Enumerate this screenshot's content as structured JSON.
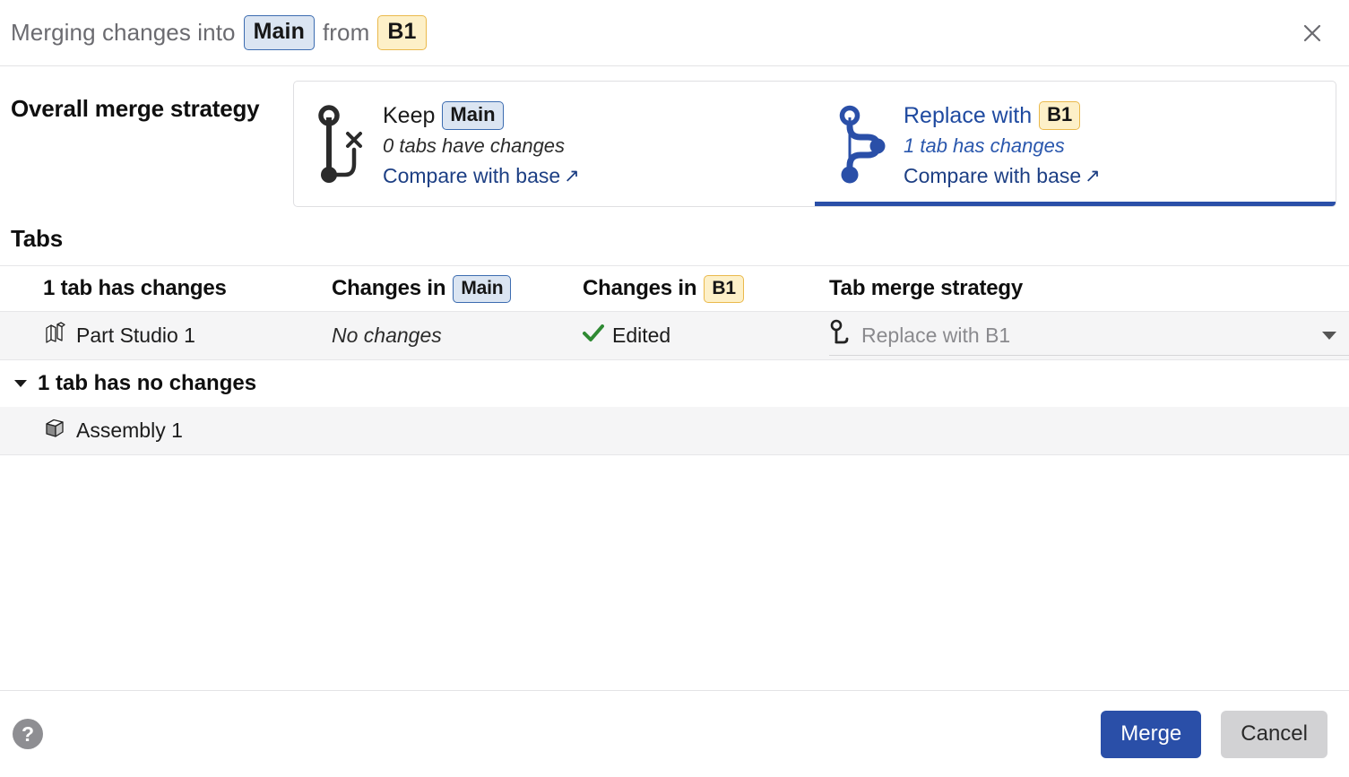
{
  "header": {
    "prefix": "Merging changes into",
    "target_branch": "Main",
    "middle": "from",
    "source_branch": "B1",
    "close_icon": "close-icon"
  },
  "overall_strategy": {
    "label": "Overall merge strategy",
    "options": [
      {
        "action": "Keep",
        "branch": "Main",
        "branch_type": "main",
        "summary": "0 tabs have changes",
        "link": "Compare with base",
        "link_arrow": "↗",
        "selected": false,
        "icon": "branch-discard-icon"
      },
      {
        "action": "Replace with",
        "branch": "B1",
        "branch_type": "b1",
        "summary": "1 tab has changes",
        "link": "Compare with base",
        "link_arrow": "↗",
        "selected": true,
        "icon": "branch-merge-icon"
      }
    ]
  },
  "tabs_section": {
    "title": "Tabs",
    "columns": {
      "tab": "1 tab has changes",
      "changes_in_main_prefix": "Changes in",
      "changes_in_main_branch": "Main",
      "changes_in_b1_prefix": "Changes in",
      "changes_in_b1_branch": "B1",
      "strategy": "Tab merge strategy"
    },
    "changed_rows": [
      {
        "name": "Part Studio 1",
        "icon": "part-studio-icon",
        "changes_in_main": "No changes",
        "changes_in_b1": "Edited",
        "b1_status_icon": "check-icon",
        "strategy_value": "Replace with B1",
        "strategy_icon": "branch-small-icon",
        "caret_icon": "chevron-down-icon"
      }
    ],
    "unchanged_group": {
      "label": "1 tab has no changes",
      "caret_icon": "caret-down-icon",
      "rows": [
        {
          "name": "Assembly 1",
          "icon": "assembly-icon"
        }
      ]
    }
  },
  "footer": {
    "help_icon": "help-icon",
    "help_glyph": "?",
    "merge_label": "Merge",
    "cancel_label": "Cancel"
  },
  "colors": {
    "accent_blue": "#2a4fa8",
    "link_blue": "#1d3f84",
    "green_check": "#2f8a33",
    "badge_main_bg": "#dbe5f2",
    "badge_main_border": "#3c6cb0",
    "badge_b1_bg": "#fdf0c8",
    "badge_b1_border": "#eab94c",
    "row_shade": "#f5f5f6"
  }
}
